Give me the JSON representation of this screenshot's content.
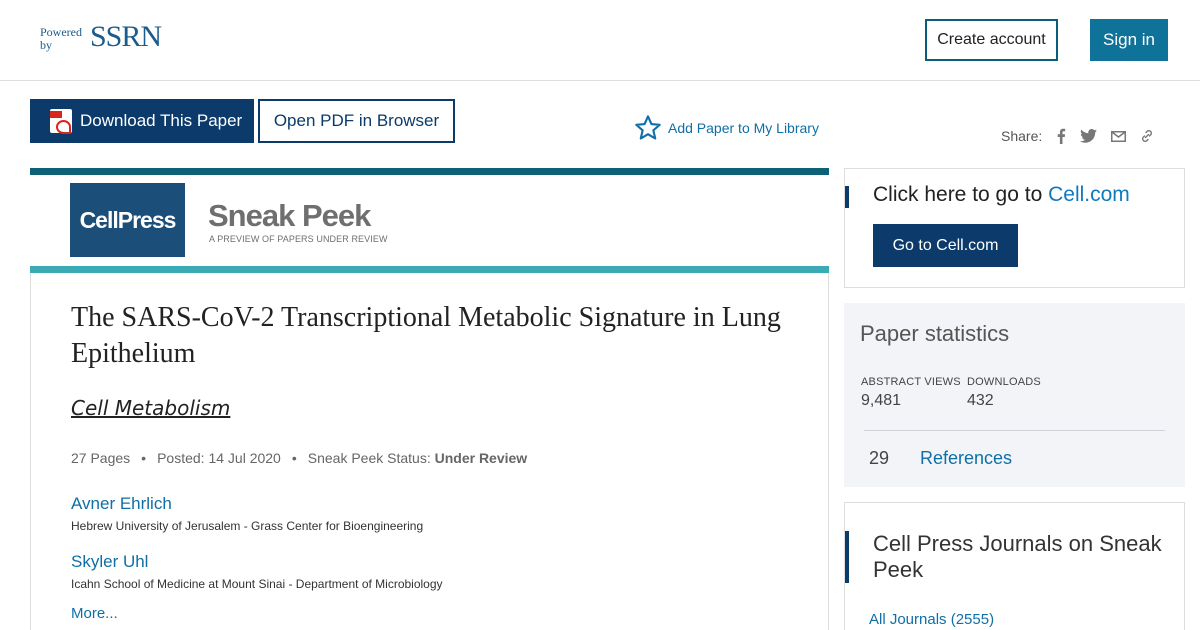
{
  "header": {
    "logo_powered": "Powered by",
    "logo_brand": "SSRN",
    "create_account": "Create account",
    "sign_in": "Sign in"
  },
  "actions": {
    "download": "Download This Paper",
    "open_pdf": "Open PDF in Browser",
    "add_library": "Add Paper to My Library",
    "share_label": "Share:"
  },
  "banner": {
    "cellpress": "CellPress",
    "sneak_peek": "Sneak Peek",
    "sneak_sub": "A PREVIEW OF PAPERS UNDER REVIEW"
  },
  "paper": {
    "title": "The SARS-CoV-2 Transcriptional Metabolic Signature in Lung Epithelium",
    "journal": "Cell Metabolism",
    "pages": "27 Pages",
    "posted": "Posted: 14 Jul 2020",
    "status_label": "Sneak Peek Status:",
    "status_value": "Under Review",
    "authors": [
      {
        "name": "Avner Ehrlich",
        "affiliation": "Hebrew University of Jerusalem - Grass Center for Bioengineering"
      },
      {
        "name": "Skyler Uhl",
        "affiliation": "Icahn School of Medicine at Mount Sinai - Department of Microbiology"
      }
    ],
    "more": "More..."
  },
  "sidebar": {
    "cell_prompt": "Click here to go to",
    "cell_link": "Cell.com",
    "cell_button": "Go to Cell.com",
    "stats_title": "Paper statistics",
    "abstract_views_label": "ABSTRACT VIEWS",
    "abstract_views": "9,481",
    "downloads_label": "DOWNLOADS",
    "downloads": "432",
    "references_count": "29",
    "references_label": "References",
    "journals_title": "Cell Press Journals on Sneak Peek",
    "all_journals": "All Journals (2555)"
  },
  "colors": {
    "brand_navy": "#0b3a6b",
    "link_blue": "#0f6fa6",
    "teal": "#3aabb5",
    "dark_teal": "#0e6076"
  }
}
